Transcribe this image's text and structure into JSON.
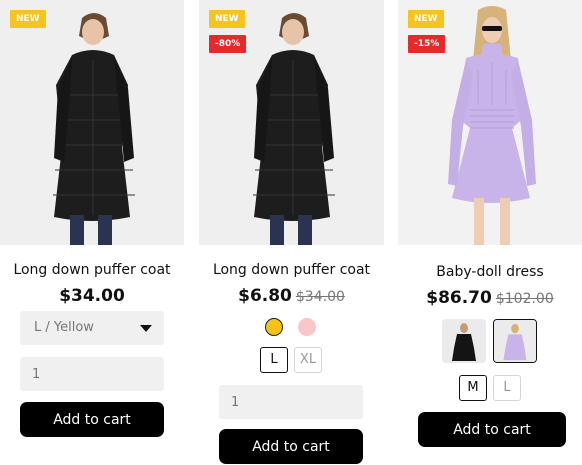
{
  "products": [
    {
      "badge_new": "NEW",
      "title": "Long down puffer coat",
      "price": "$34.00",
      "variant_select": "L / Yellow",
      "quantity_placeholder": "1",
      "add_to_cart": "Add to cart",
      "image_icon": "black-puffer-coat-photo"
    },
    {
      "badge_new": "NEW",
      "badge_discount": "-80%",
      "title": "Long down puffer coat",
      "price": "$6.80",
      "compare_price": "$34.00",
      "colors": [
        {
          "name": "yellow",
          "hex": "#f6c316",
          "selected": true
        },
        {
          "name": "pink",
          "hex": "#f7c7cc",
          "selected": false
        }
      ],
      "sizes": [
        {
          "label": "L",
          "selected": true
        },
        {
          "label": "XL",
          "selected": false
        }
      ],
      "quantity_placeholder": "1",
      "add_to_cart": "Add to cart",
      "image_icon": "black-puffer-coat-photo"
    },
    {
      "badge_new": "NEW",
      "badge_discount": "-15%",
      "title": "Baby-doll dress",
      "price": "$86.70",
      "compare_price": "$102.00",
      "thumbnails": [
        {
          "icon": "black-dress-thumbnail",
          "selected": false
        },
        {
          "icon": "lavender-dress-thumbnail",
          "selected": true
        }
      ],
      "sizes": [
        {
          "label": "M",
          "selected": true
        },
        {
          "label": "L",
          "selected": false
        }
      ],
      "add_to_cart": "Add to cart",
      "image_icon": "lavender-dress-photo"
    }
  ],
  "colors": {
    "badge_new": "#f7c31e",
    "badge_discount": "#e52a2a",
    "button": "#000000",
    "input_bg": "#f0f0f0"
  }
}
